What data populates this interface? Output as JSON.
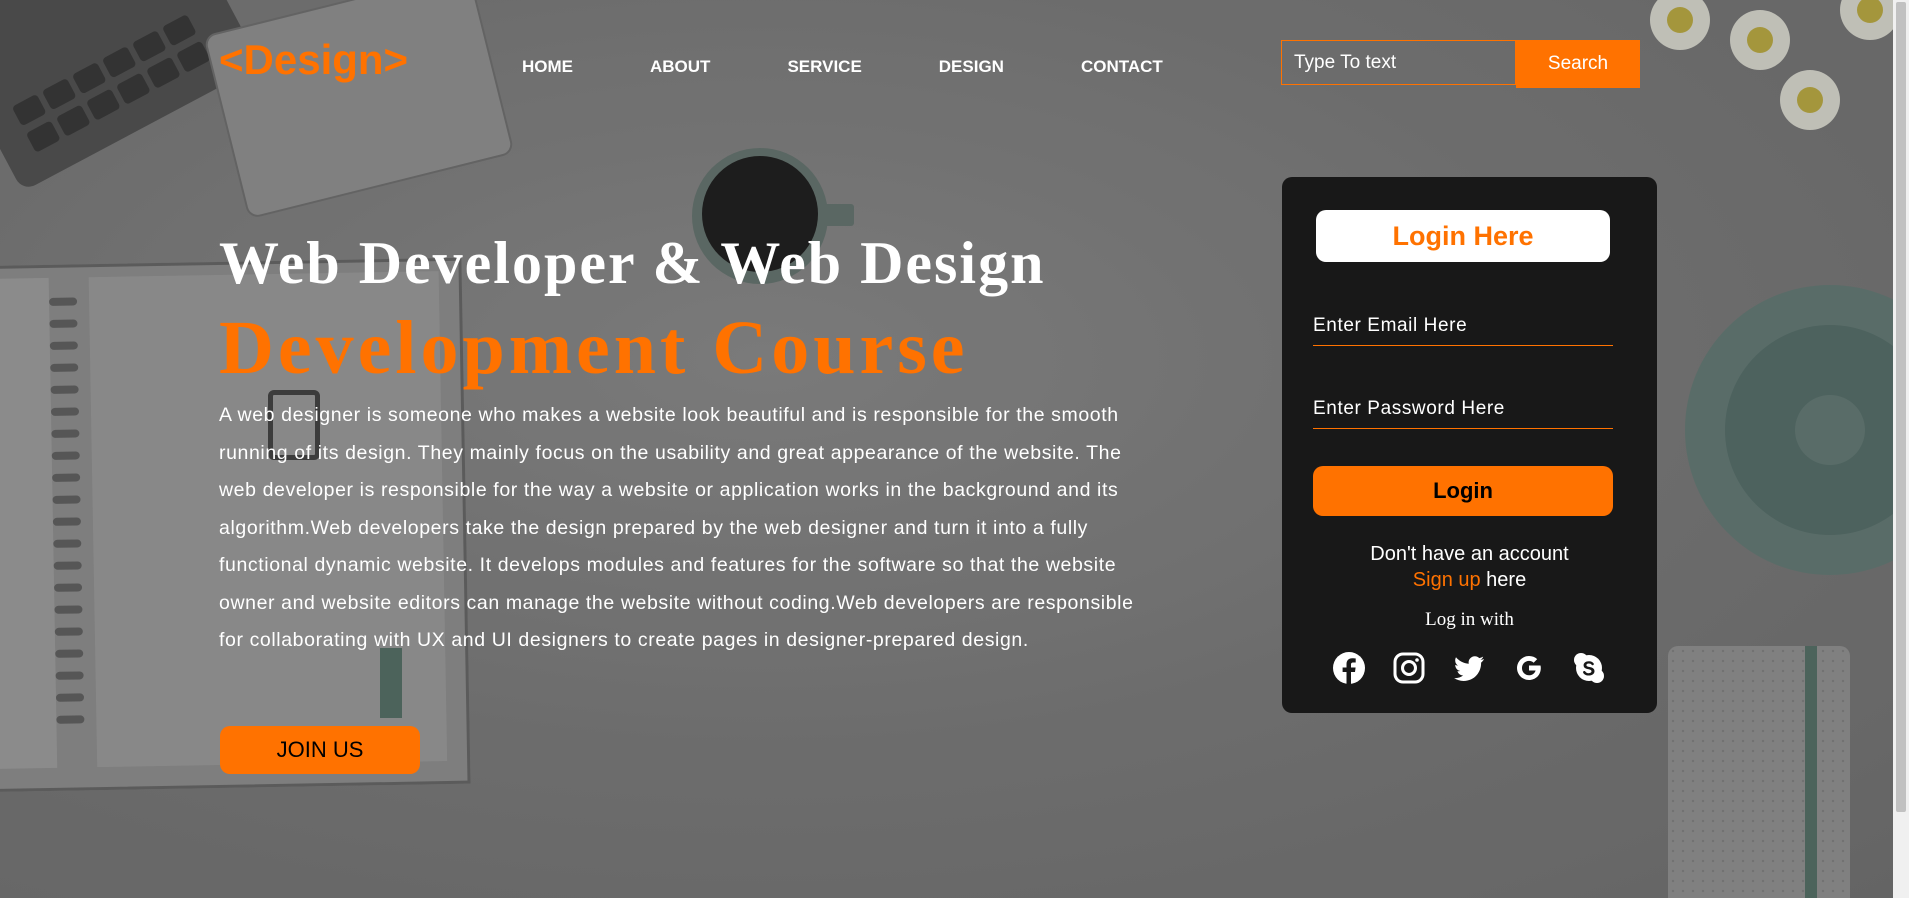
{
  "header": {
    "logo": "<Design>",
    "nav": [
      {
        "label": "HOME"
      },
      {
        "label": "ABOUT"
      },
      {
        "label": "SERVICE"
      },
      {
        "label": "DESIGN"
      },
      {
        "label": "CONTACT"
      }
    ],
    "search": {
      "placeholder": "Type To text",
      "button_label": "Search"
    }
  },
  "hero": {
    "title": "Web Developer & Web Design",
    "subtitle": "Development Course",
    "description": "A web designer is someone who makes a website look beautiful and is responsible for the smooth running of its design. They mainly focus on the usability and great appearance of the website. The web developer is responsible for the way a website or application works in the background and its algorithm.Web developers take the design prepared by the web designer and turn it into a fully functional dynamic website. It develops modules and features for the software so that the website owner and website editors can manage the website without coding.Web developers are responsible for collaborating with UX and UI designers to create pages in designer-prepared design.",
    "join_label": "JOIN US"
  },
  "login": {
    "title": "Login Here",
    "email_placeholder": "Enter Email Here",
    "password_placeholder": "Enter Password Here",
    "button_label": "Login",
    "no_account_text": "Don't have an account",
    "signup_link": "Sign up",
    "signup_suffix": " here",
    "login_with": "Log in with",
    "socials": [
      {
        "icon": "facebook-icon"
      },
      {
        "icon": "instagram-icon"
      },
      {
        "icon": "twitter-icon"
      },
      {
        "icon": "google-icon"
      },
      {
        "icon": "skype-icon"
      }
    ]
  },
  "colors": {
    "accent": "#ff7200",
    "card_background": "#181818",
    "text": "#ffffff"
  }
}
